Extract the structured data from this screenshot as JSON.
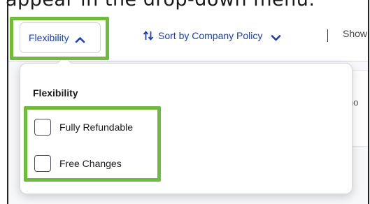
{
  "heading_fragment": "appear in the drop-down menu.",
  "toolbar": {
    "filter_label": "Flexibility",
    "sort_label": "Sort by Company Policy",
    "divider": "|",
    "show_label": "Show"
  },
  "dropdown": {
    "title": "Flexibility",
    "options": [
      {
        "label": "Fully Refundable",
        "checked": false
      },
      {
        "label": "Free Changes",
        "checked": false
      }
    ]
  },
  "background_peek": "ho",
  "colors": {
    "accent_link": "#1d3fa8",
    "highlight": "#6fba3f"
  },
  "icons": {
    "filter_chevron": "chevron-up-icon",
    "sort": "sort-arrows-icon",
    "sort_chevron": "chevron-down-icon"
  }
}
